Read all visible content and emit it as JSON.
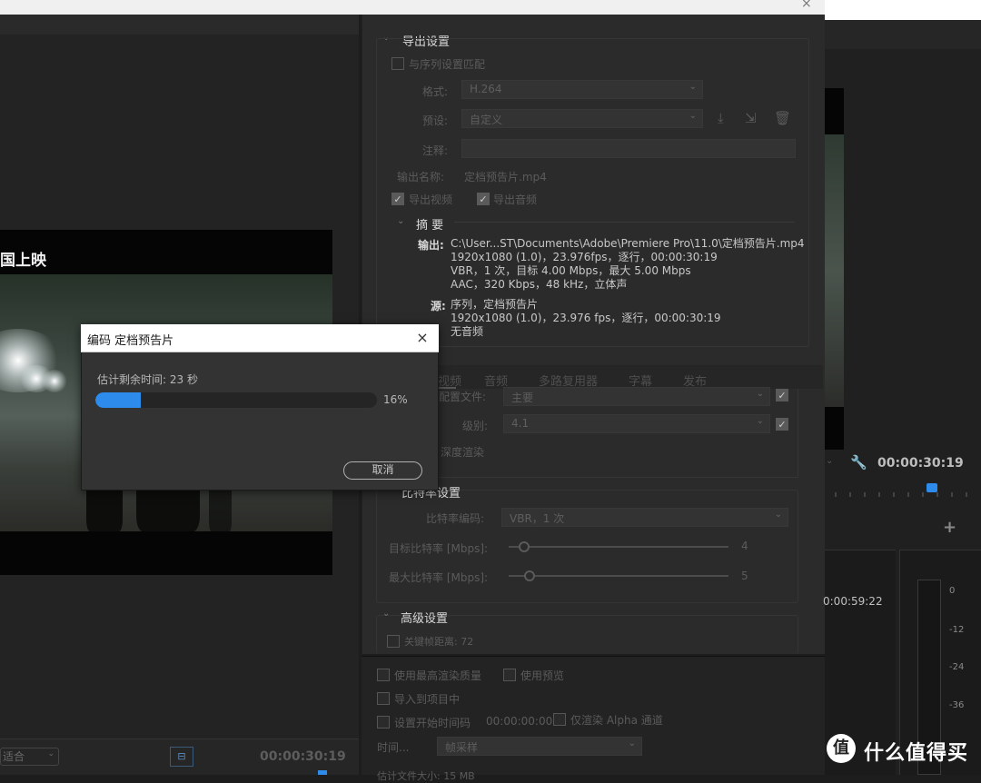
{
  "window": {
    "close_glyph": "×"
  },
  "source_monitor": {
    "video_caption": "国上映",
    "fit_select": "适合",
    "timecode": "00:00:30:19"
  },
  "export_settings": {
    "section_title": "导出设置",
    "match_sequence": "与序列设置匹配",
    "format_label": "格式:",
    "format_value": "H.264",
    "preset_label": "预设:",
    "preset_value": "自定义",
    "comment_label": "注释:",
    "comment_value": "",
    "output_name_label": "输出名称:",
    "output_name_value": "定档预告片.mp4",
    "export_video": "导出视频",
    "export_audio": "导出音频",
    "summary_title": "摘 要",
    "output_label": "输出:",
    "output_lines": [
      "C:\\User...ST\\Documents\\Adobe\\Premiere  Pro\\11.0\\定档预告片.mp4",
      "1920x1080 (1.0)，23.976fps，逐行，00:00:30:19",
      "VBR，1 次，目标 4.00 Mbps，最大 5.00 Mbps",
      "AAC，320 Kbps，48  kHz，立体声"
    ],
    "source_label": "源:",
    "source_lines": [
      "序列，定档预告片",
      "1920x1080 (1.0)，23.976 fps，逐行，00:00:30:19",
      "无音频"
    ]
  },
  "tabs": [
    "视频",
    "音频",
    "多路复用器",
    "字幕",
    "发布"
  ],
  "video_settings": {
    "profile_label": "配置文件:",
    "profile_value": "主要",
    "level_label": "级别:",
    "level_value": "4.1",
    "depth_render": "深度渲染"
  },
  "bitrate": {
    "title": "比特率设置",
    "encoding_label": "比特率编码:",
    "encoding_value": "VBR，1 次",
    "target_label": "目标比特率 [Mbps]:",
    "target_value": "4",
    "max_label": "最大比特率 [Mbps]:",
    "max_value": "5"
  },
  "advanced": {
    "title": "高级设置",
    "keyframe": "关键帧距离:",
    "keyframe_value": "72"
  },
  "bottom_options": {
    "max_quality": "使用最高渲染质量",
    "use_preview": "使用预览",
    "import_project": "导入到项目中",
    "set_start_tc": "设置开始时间码",
    "start_tc_value": "00:00:00:00",
    "alpha_only": "仅渲染 Alpha 通道",
    "time_interp_label": "时间...",
    "time_interp_value": "帧采样",
    "file_size": "估计文件大小: 15 MB"
  },
  "program_monitor": {
    "timecode": "00:00:30:19",
    "timeline_tc": "0:00:59:22",
    "meter_labels": [
      "0",
      "-12",
      "-24",
      "-36"
    ]
  },
  "encode_dialog": {
    "title": "编码 定档预告片",
    "close_glyph": "×",
    "remaining": "估计剩余时间: 23 秒",
    "progress": 0.16,
    "progress_label": "16%",
    "cancel": "取消"
  },
  "watermark": {
    "logo_glyph": "值",
    "text": "什么值得买"
  },
  "colors": {
    "accent": "#2d8ceb",
    "panel": "#2b2b2b",
    "dialog": "#333333"
  }
}
